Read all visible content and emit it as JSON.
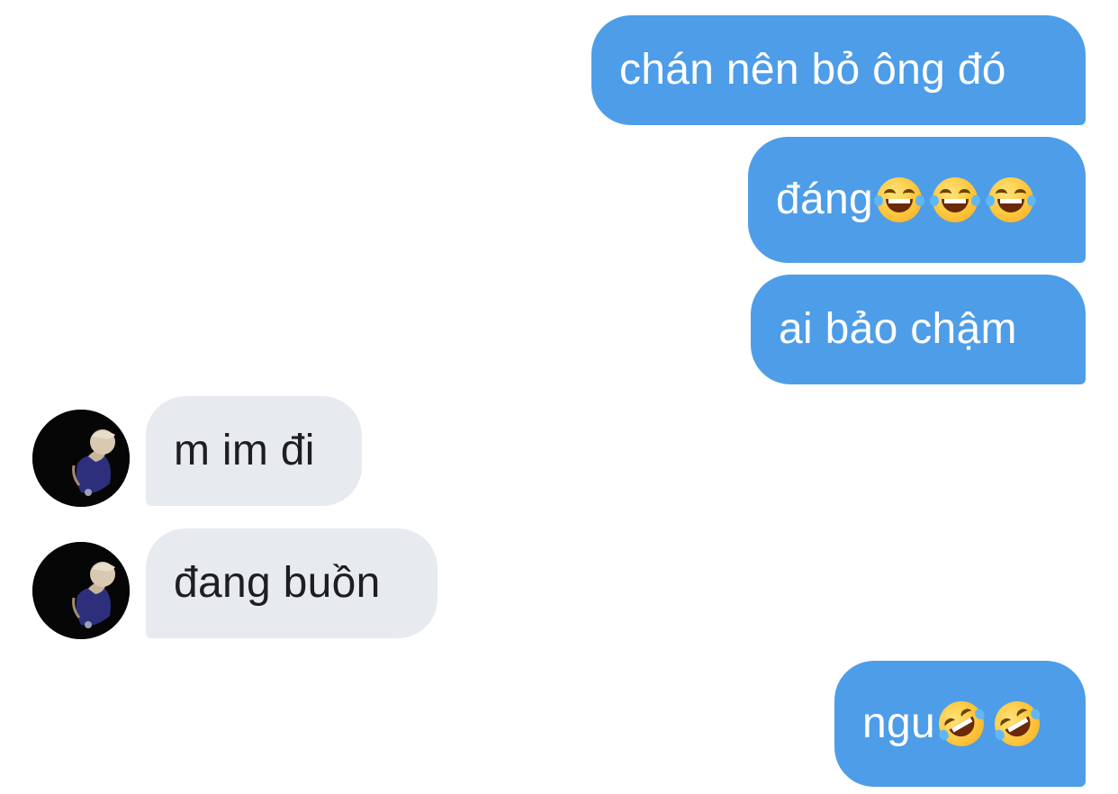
{
  "conversation": {
    "messages": [
      {
        "direction": "outgoing",
        "text": "chán nên bỏ ông đó",
        "emoji": []
      },
      {
        "direction": "outgoing",
        "text": "đáng",
        "emoji": [
          "face-with-tears-of-joy-icon",
          "face-with-tears-of-joy-icon",
          "face-with-tears-of-joy-icon"
        ]
      },
      {
        "direction": "outgoing",
        "text": "ai bảo chậm",
        "emoji": []
      },
      {
        "direction": "incoming",
        "text": "m im đi",
        "emoji": []
      },
      {
        "direction": "incoming",
        "text": "đang buồn",
        "emoji": []
      },
      {
        "direction": "outgoing",
        "text": "ngu",
        "emoji": [
          "rolling-on-the-floor-laughing-icon",
          "rolling-on-the-floor-laughing-icon"
        ]
      }
    ]
  },
  "colors": {
    "outgoing_bubble": "#4e9de8",
    "incoming_bubble": "#e7eaef",
    "outgoing_text": "#ffffff",
    "incoming_text": "#1c1e21"
  }
}
